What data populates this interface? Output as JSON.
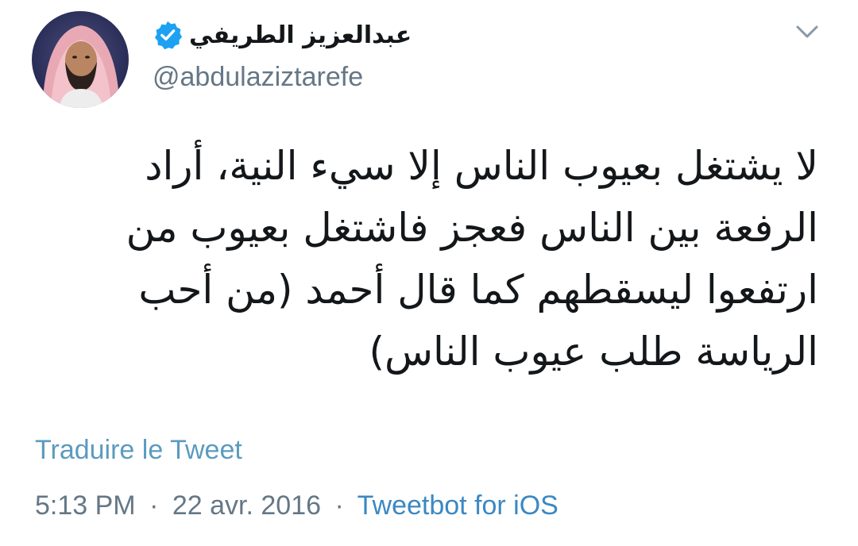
{
  "tweet": {
    "author": {
      "display_name": "عبدالعزيز الطريفي",
      "handle": "@abdulaziztarefe",
      "verified": true
    },
    "text_lines": [
      "لا يشتغل بعيوب الناس إلا سيء النية، أراد",
      "الرفعة بين الناس فعجز فاشتغل بعيوب من",
      "ارتفعوا ليسقطهم كما قال أحمد (من أحب",
      "الرياسة طلب عيوب الناس)"
    ],
    "translate_label": "Traduire le Tweet",
    "time": "5:13 PM",
    "separator": "·",
    "date": "22 avr. 2016",
    "source": "Tweetbot for iOS"
  },
  "icons": {
    "verified": "verified-badge-icon",
    "menu": "chevron-down-icon"
  },
  "colors": {
    "verified_blue": "#1da1f2",
    "link_blue": "#3b88c3",
    "muted_gray": "#657786",
    "text": "#14171a"
  }
}
